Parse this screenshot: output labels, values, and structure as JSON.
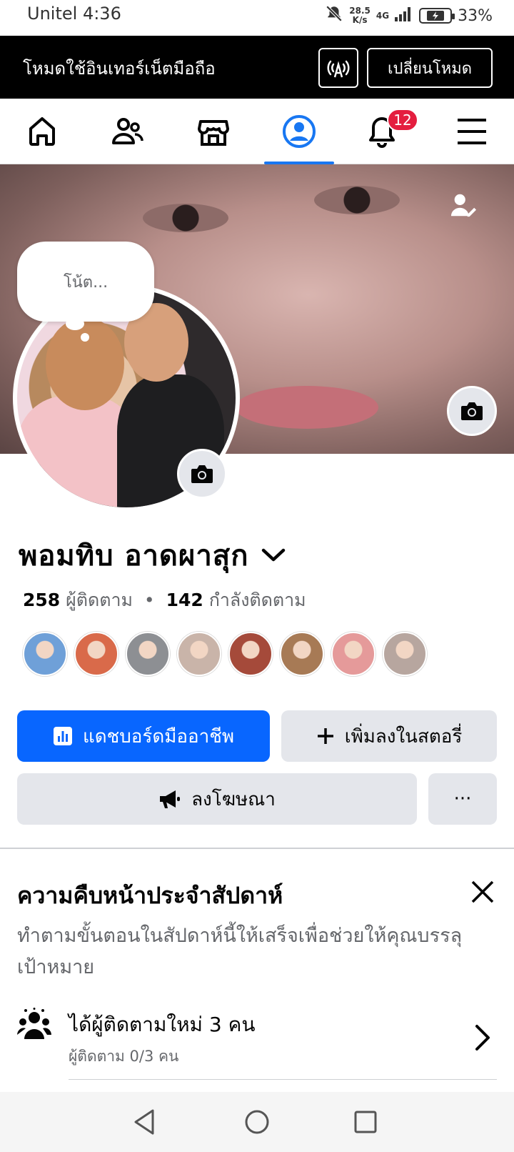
{
  "status_bar": {
    "carrier": "Unitel",
    "time": "4:36",
    "speed_value": "28.5",
    "speed_unit": "K/s",
    "network": "4G",
    "battery": "33%"
  },
  "data_banner": {
    "text": "โหมดใช้อินเทอร์เน็ตมือถือ",
    "switch_label": "เปลี่ยนโหมด"
  },
  "nav": {
    "notification_count": "12"
  },
  "note": {
    "placeholder": "โน้ต..."
  },
  "profile": {
    "name": "พอมทิบ อาดผาสุก",
    "followers_count": "258",
    "followers_label": "ผู้ติดตาม",
    "separator": "•",
    "following_count": "142",
    "following_label": "กำลังติดตาม"
  },
  "friends": [
    {
      "color": "#6fa0d8"
    },
    {
      "color": "#d96a4a"
    },
    {
      "color": "#8d8f93"
    },
    {
      "color": "#c9b4a9"
    },
    {
      "color": "#a54a3a"
    },
    {
      "color": "#a77a55"
    },
    {
      "color": "#e59a9a"
    },
    {
      "color": "#b7a69f"
    }
  ],
  "actions": {
    "dashboard": "แดชบอร์ดมืออาชีพ",
    "add_story": "เพิ่มลงในสตอรี่",
    "advertise": "ลงโฆษณา",
    "more": "···"
  },
  "weekly": {
    "title": "ความคืบหน้าประจำสัปดาห์",
    "description": "ทำตามขั้นตอนในสัปดาห์นี้ให้เสร็จเพื่อช่วยให้คุณบรรลุเป้าหมาย",
    "item_title": "ได้ผู้ติดตามใหม่ 3 คน",
    "item_subtitle": "ผู้ติดตาม 0/3 คน"
  },
  "colors": {
    "accent": "#0866ff",
    "badge": "#e41e3f",
    "button_gray": "#e4e6eb"
  }
}
